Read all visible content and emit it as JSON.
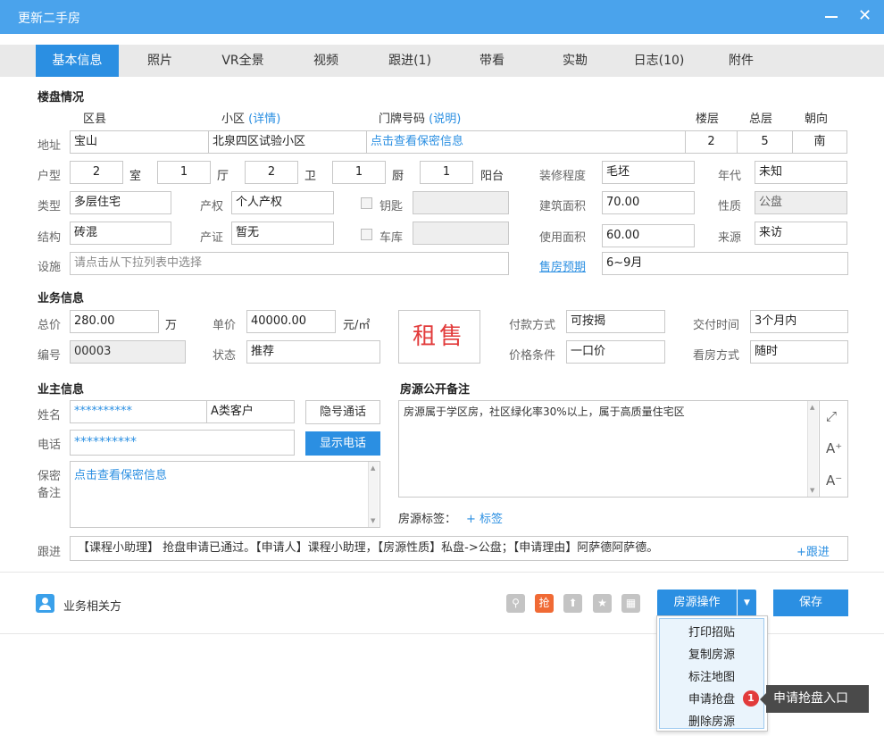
{
  "window": {
    "title": "更新二手房"
  },
  "tabs": [
    "基本信息",
    "照片",
    "VR全景",
    "视频",
    "跟进(1)",
    "带看",
    "实勘",
    "日志(10)",
    "附件"
  ],
  "sections": {
    "property": "楼盘情况",
    "business": "业务信息",
    "owner": "业主信息",
    "remarks": "房源公开备注"
  },
  "address": {
    "district_label": "区县",
    "community_label": "小区",
    "community_link": "(详情)",
    "door_label": "门牌号码",
    "door_link": "(说明)",
    "floor_label": "楼层",
    "total_floor_label": "总层",
    "orientation_label": "朝向",
    "row_label": "地址",
    "district": "宝山",
    "community": "北泉四区试验小区",
    "door": "点击查看保密信息",
    "floor": "2",
    "total_floor": "5",
    "orientation": "南"
  },
  "layout": {
    "label": "户型",
    "rooms": "2",
    "rooms_unit": "室",
    "halls": "1",
    "halls_unit": "厅",
    "baths": "2",
    "baths_unit": "卫",
    "kitchens": "1",
    "kitchens_unit": "厨",
    "balconies": "1",
    "balconies_unit": "阳台"
  },
  "decor": {
    "label": "装修程度",
    "value": "毛坯"
  },
  "year": {
    "label": "年代",
    "value": "未知"
  },
  "type": {
    "label": "类型",
    "value": "多层住宅"
  },
  "ownership": {
    "label": "产权",
    "value": "个人产权"
  },
  "key": {
    "label": "钥匙",
    "value": ""
  },
  "area": {
    "label": "建筑面积",
    "value": "70.00"
  },
  "nature": {
    "label": "性质",
    "value": "公盘"
  },
  "structure": {
    "label": "结构",
    "value": "砖混"
  },
  "certificate": {
    "label": "产证",
    "value": "暂无"
  },
  "garage": {
    "label": "车库",
    "value": ""
  },
  "usable": {
    "label": "使用面积",
    "value": "60.00"
  },
  "source": {
    "label": "来源",
    "value": "来访"
  },
  "facility": {
    "label": "设施",
    "placeholder": "请点击从下拉列表中选择"
  },
  "sale_expect": {
    "label": "售房预期",
    "value": "6~9月"
  },
  "price": {
    "total_label": "总价",
    "total": "280.00",
    "total_unit": "万",
    "unit_label": "单价",
    "unit": "40000.00",
    "unit_unit": "元/㎡"
  },
  "stamp": "租售",
  "payment": {
    "label": "付款方式",
    "value": "可按揭"
  },
  "delivery": {
    "label": "交付时间",
    "value": "3个月内"
  },
  "number": {
    "label": "编号",
    "value": "00003"
  },
  "status": {
    "label": "状态",
    "value": "推荐"
  },
  "price_cond": {
    "label": "价格条件",
    "value": "一口价"
  },
  "viewing": {
    "label": "看房方式",
    "value": "随时"
  },
  "owner": {
    "name_label": "姓名",
    "name": "**********",
    "customer_type": "A类客户",
    "hidden_call": "隐号通话",
    "phone_label": "电话",
    "phone": "**********",
    "show_phone": "显示电话",
    "secret_label_1": "保密",
    "secret_label_2": "备注",
    "secret": "点击查看保密信息"
  },
  "remarks": {
    "text": "房源属于学区房，社区绿化率30%以上，属于高质量住宅区",
    "tags_label": "房源标签：",
    "add_tag": "+ 标签"
  },
  "followup": {
    "label": "跟进",
    "text": "【课程小助理】 抢盘申请已通过。【申请人】课程小助理，【房源性质】私盘->公盘；【申请理由】阿萨德阿萨德。",
    "add": "+跟进"
  },
  "bottom": {
    "related": "业务相关方",
    "grab_icon": "抢",
    "ops": "房源操作",
    "save": "保存"
  },
  "menu": [
    "打印招贴",
    "复制房源",
    "标注地图",
    "申请抢盘",
    "删除房源"
  ],
  "tip": {
    "badge": "1",
    "text": "申请抢盘入口"
  },
  "colors": {
    "accent": "#2b8fe2",
    "titlebar": "#4aa3ec",
    "stamp": "#e23b3b",
    "grab": "#f06a35"
  }
}
